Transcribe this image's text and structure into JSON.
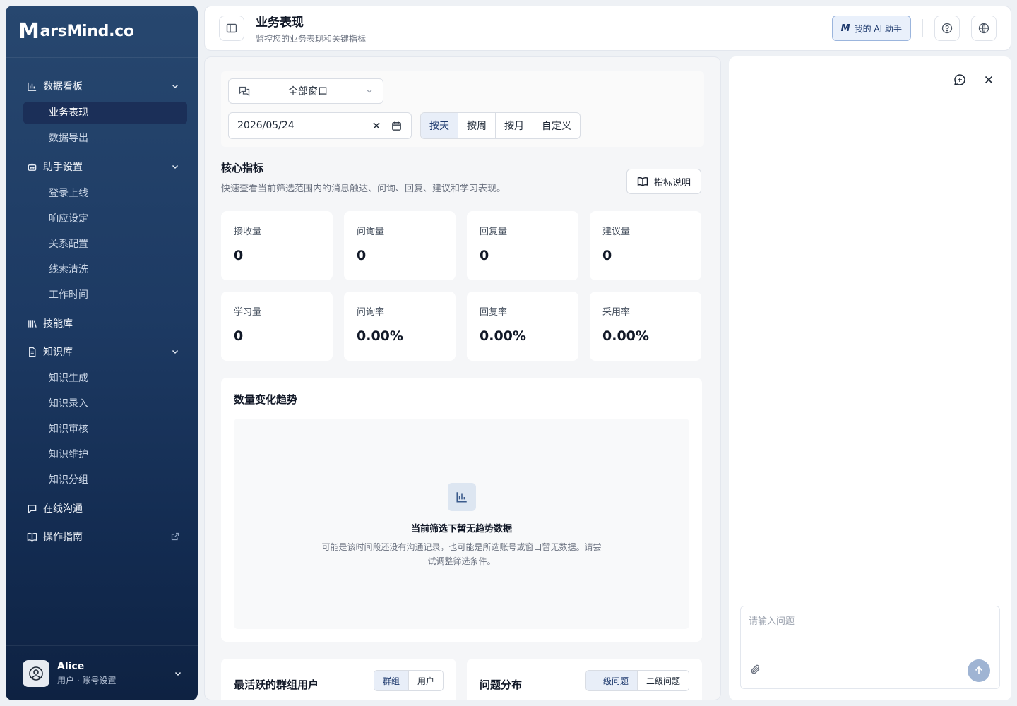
{
  "brand": {
    "logo_mark": "M",
    "logo_text": "arsMind.co"
  },
  "sidebar": {
    "groups": [
      {
        "label": "数据看板",
        "icon": "bar-chart-icon",
        "expanded": true,
        "items": [
          {
            "label": "业务表现",
            "active": true
          },
          {
            "label": "数据导出"
          }
        ]
      },
      {
        "label": "助手设置",
        "icon": "robot-icon",
        "expanded": true,
        "items": [
          {
            "label": "登录上线"
          },
          {
            "label": "响应设定"
          },
          {
            "label": "关系配置"
          },
          {
            "label": "线索清洗"
          },
          {
            "label": "工作时间"
          }
        ]
      },
      {
        "label": "技能库",
        "icon": "library-icon"
      },
      {
        "label": "知识库",
        "icon": "document-icon",
        "expanded": true,
        "items": [
          {
            "label": "知识生成"
          },
          {
            "label": "知识录入"
          },
          {
            "label": "知识审核"
          },
          {
            "label": "知识维护"
          },
          {
            "label": "知识分组"
          }
        ]
      },
      {
        "label": "在线沟通",
        "icon": "chat-icon"
      },
      {
        "label": "操作指南",
        "icon": "book-icon",
        "external": true
      }
    ],
    "user": {
      "name": "Alice",
      "subtitle": "用户 · 账号设置"
    }
  },
  "header": {
    "title": "业务表现",
    "subtitle": "监控您的业务表现和关键指标",
    "ai_button": "我的 AI 助手"
  },
  "filters": {
    "window_select": "全部窗口",
    "date": "2026/05/24",
    "periods": [
      "按天",
      "按周",
      "按月",
      "自定义"
    ],
    "active_period": "按天"
  },
  "core": {
    "title": "核心指标",
    "desc": "快速查看当前筛选范围内的消息触达、问询、回复、建议和学习表现。",
    "doc_button": "指标说明",
    "metrics": [
      {
        "label": "接收量",
        "value": "0"
      },
      {
        "label": "问询量",
        "value": "0"
      },
      {
        "label": "回复量",
        "value": "0"
      },
      {
        "label": "建议量",
        "value": "0"
      },
      {
        "label": "学习量",
        "value": "0"
      },
      {
        "label": "问询率",
        "value": "0.00%"
      },
      {
        "label": "回复率",
        "value": "0.00%"
      },
      {
        "label": "采用率",
        "value": "0.00%"
      }
    ]
  },
  "trend": {
    "title": "数量变化趋势",
    "empty_title": "当前筛选下暂无趋势数据",
    "empty_desc": "可能是该时间段还没有沟通记录，也可能是所选账号或窗口暂无数据。请尝试调整筛选条件。"
  },
  "bottom": {
    "left": {
      "title": "最活跃的群组用户",
      "tabs": [
        "群组",
        "用户"
      ]
    },
    "right": {
      "title": "问题分布",
      "tabs": [
        "一级问题",
        "二级问题"
      ]
    }
  },
  "assistant": {
    "placeholder": "请输入问题"
  },
  "colors": {
    "sidebar": "#1d3a63",
    "accent": "#1e3a6e",
    "active_item": "#1b2f58"
  }
}
